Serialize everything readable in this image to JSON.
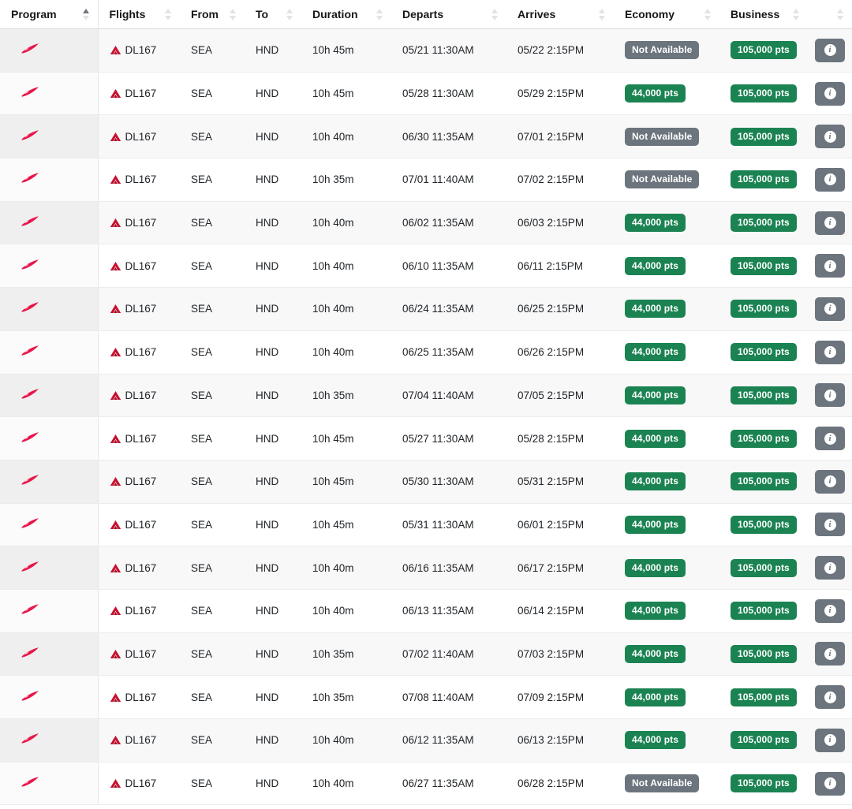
{
  "table": {
    "columns": [
      {
        "key": "program",
        "label": "Program",
        "sort": "asc",
        "sortable": true
      },
      {
        "key": "flights",
        "label": "Flights",
        "sort": "none",
        "sortable": true
      },
      {
        "key": "from",
        "label": "From",
        "sort": "none",
        "sortable": true
      },
      {
        "key": "to",
        "label": "To",
        "sort": "none",
        "sortable": true
      },
      {
        "key": "duration",
        "label": "Duration",
        "sort": "none",
        "sortable": true
      },
      {
        "key": "departs",
        "label": "Departs",
        "sort": "none",
        "sortable": true
      },
      {
        "key": "arrives",
        "label": "Arrives",
        "sort": "none",
        "sortable": true
      },
      {
        "key": "economy",
        "label": "Economy",
        "sort": "none",
        "sortable": true
      },
      {
        "key": "business",
        "label": "Business",
        "sort": "none",
        "sortable": true
      },
      {
        "key": "actions",
        "label": "",
        "sort": "none",
        "sortable": true
      }
    ],
    "icons": {
      "program_logo": "virgin-atlantic-logo-icon",
      "airline_logo": "delta-triangle-icon",
      "sort": "sort-arrows-icon",
      "info": "info-circle-icon"
    },
    "colors": {
      "points_badge": "#1b8352",
      "unavailable_badge": "#6c757d",
      "info_button": "#6c757d",
      "airline_red": "#c8102e",
      "program_red": "#e8174a",
      "row_stripe": "#f8f8f9",
      "sort_active": "#6c737c",
      "sort_inactive": "#e3e3e5"
    },
    "labels": {
      "not_available": "Not Available",
      "info_button_glyph": "i"
    },
    "rows": [
      {
        "flight": "DL167",
        "from": "SEA",
        "to": "HND",
        "duration": "10h 45m",
        "departs": "05/21 11:30AM",
        "arrives": "05/22 2:15PM",
        "economy": "Not Available",
        "economy_available": false,
        "business": "105,000 pts",
        "business_available": true
      },
      {
        "flight": "DL167",
        "from": "SEA",
        "to": "HND",
        "duration": "10h 45m",
        "departs": "05/28 11:30AM",
        "arrives": "05/29 2:15PM",
        "economy": "44,000 pts",
        "economy_available": true,
        "business": "105,000 pts",
        "business_available": true
      },
      {
        "flight": "DL167",
        "from": "SEA",
        "to": "HND",
        "duration": "10h 40m",
        "departs": "06/30 11:35AM",
        "arrives": "07/01 2:15PM",
        "economy": "Not Available",
        "economy_available": false,
        "business": "105,000 pts",
        "business_available": true
      },
      {
        "flight": "DL167",
        "from": "SEA",
        "to": "HND",
        "duration": "10h 35m",
        "departs": "07/01 11:40AM",
        "arrives": "07/02 2:15PM",
        "economy": "Not Available",
        "economy_available": false,
        "business": "105,000 pts",
        "business_available": true
      },
      {
        "flight": "DL167",
        "from": "SEA",
        "to": "HND",
        "duration": "10h 40m",
        "departs": "06/02 11:35AM",
        "arrives": "06/03 2:15PM",
        "economy": "44,000 pts",
        "economy_available": true,
        "business": "105,000 pts",
        "business_available": true
      },
      {
        "flight": "DL167",
        "from": "SEA",
        "to": "HND",
        "duration": "10h 40m",
        "departs": "06/10 11:35AM",
        "arrives": "06/11 2:15PM",
        "economy": "44,000 pts",
        "economy_available": true,
        "business": "105,000 pts",
        "business_available": true
      },
      {
        "flight": "DL167",
        "from": "SEA",
        "to": "HND",
        "duration": "10h 40m",
        "departs": "06/24 11:35AM",
        "arrives": "06/25 2:15PM",
        "economy": "44,000 pts",
        "economy_available": true,
        "business": "105,000 pts",
        "business_available": true
      },
      {
        "flight": "DL167",
        "from": "SEA",
        "to": "HND",
        "duration": "10h 40m",
        "departs": "06/25 11:35AM",
        "arrives": "06/26 2:15PM",
        "economy": "44,000 pts",
        "economy_available": true,
        "business": "105,000 pts",
        "business_available": true
      },
      {
        "flight": "DL167",
        "from": "SEA",
        "to": "HND",
        "duration": "10h 35m",
        "departs": "07/04 11:40AM",
        "arrives": "07/05 2:15PM",
        "economy": "44,000 pts",
        "economy_available": true,
        "business": "105,000 pts",
        "business_available": true
      },
      {
        "flight": "DL167",
        "from": "SEA",
        "to": "HND",
        "duration": "10h 45m",
        "departs": "05/27 11:30AM",
        "arrives": "05/28 2:15PM",
        "economy": "44,000 pts",
        "economy_available": true,
        "business": "105,000 pts",
        "business_available": true
      },
      {
        "flight": "DL167",
        "from": "SEA",
        "to": "HND",
        "duration": "10h 45m",
        "departs": "05/30 11:30AM",
        "arrives": "05/31 2:15PM",
        "economy": "44,000 pts",
        "economy_available": true,
        "business": "105,000 pts",
        "business_available": true
      },
      {
        "flight": "DL167",
        "from": "SEA",
        "to": "HND",
        "duration": "10h 45m",
        "departs": "05/31 11:30AM",
        "arrives": "06/01 2:15PM",
        "economy": "44,000 pts",
        "economy_available": true,
        "business": "105,000 pts",
        "business_available": true
      },
      {
        "flight": "DL167",
        "from": "SEA",
        "to": "HND",
        "duration": "10h 40m",
        "departs": "06/16 11:35AM",
        "arrives": "06/17 2:15PM",
        "economy": "44,000 pts",
        "economy_available": true,
        "business": "105,000 pts",
        "business_available": true
      },
      {
        "flight": "DL167",
        "from": "SEA",
        "to": "HND",
        "duration": "10h 40m",
        "departs": "06/13 11:35AM",
        "arrives": "06/14 2:15PM",
        "economy": "44,000 pts",
        "economy_available": true,
        "business": "105,000 pts",
        "business_available": true
      },
      {
        "flight": "DL167",
        "from": "SEA",
        "to": "HND",
        "duration": "10h 35m",
        "departs": "07/02 11:40AM",
        "arrives": "07/03 2:15PM",
        "economy": "44,000 pts",
        "economy_available": true,
        "business": "105,000 pts",
        "business_available": true
      },
      {
        "flight": "DL167",
        "from": "SEA",
        "to": "HND",
        "duration": "10h 35m",
        "departs": "07/08 11:40AM",
        "arrives": "07/09 2:15PM",
        "economy": "44,000 pts",
        "economy_available": true,
        "business": "105,000 pts",
        "business_available": true
      },
      {
        "flight": "DL167",
        "from": "SEA",
        "to": "HND",
        "duration": "10h 40m",
        "departs": "06/12 11:35AM",
        "arrives": "06/13 2:15PM",
        "economy": "44,000 pts",
        "economy_available": true,
        "business": "105,000 pts",
        "business_available": true
      },
      {
        "flight": "DL167",
        "from": "SEA",
        "to": "HND",
        "duration": "10h 40m",
        "departs": "06/27 11:35AM",
        "arrives": "06/28 2:15PM",
        "economy": "Not Available",
        "economy_available": false,
        "business": "105,000 pts",
        "business_available": true
      }
    ]
  }
}
